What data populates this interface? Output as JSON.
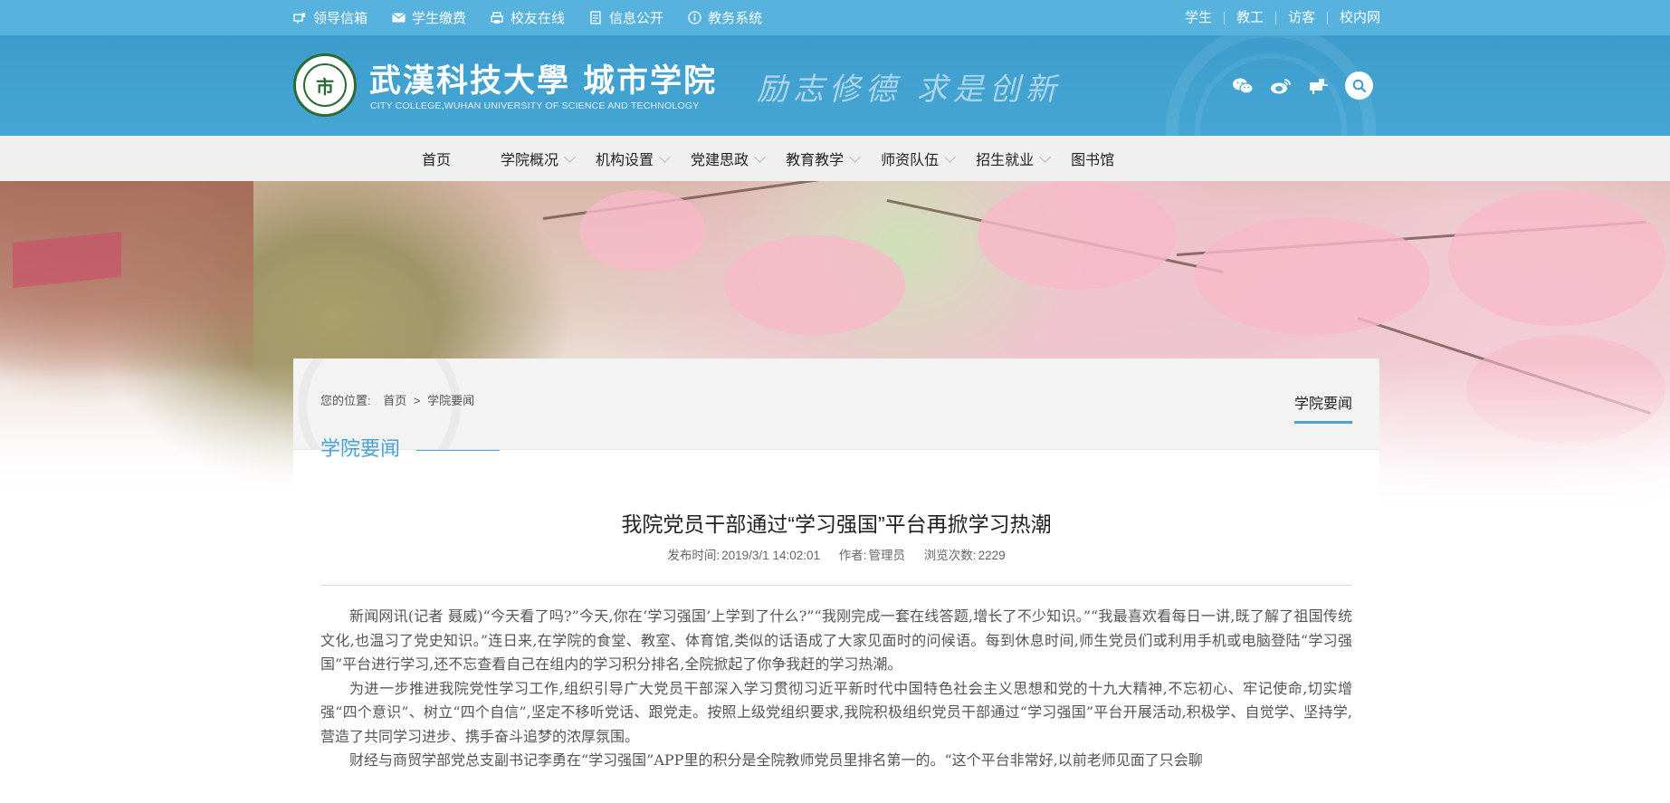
{
  "topbar": {
    "links": [
      {
        "label": "领导信箱",
        "icon": "mailbox-icon"
      },
      {
        "label": "学生缴费",
        "icon": "envelope-icon"
      },
      {
        "label": "校友在线",
        "icon": "printer-icon"
      },
      {
        "label": "信息公开",
        "icon": "document-icon"
      },
      {
        "label": "教务系统",
        "icon": "info-circle-icon"
      }
    ],
    "audience": [
      "学生",
      "教工",
      "访客",
      "校内网"
    ]
  },
  "header": {
    "logo_text": "市",
    "school_name": "武漢科技大學 城市学院",
    "school_name_en": "CITY COLLEGE,WUHAN UNIVERSITY OF SCIENCE AND TECHNOLOGY",
    "motto": "励志修德 求是创新",
    "social_icons": [
      "wechat-icon",
      "weibo-icon",
      "mailbox-icon",
      "search-icon"
    ],
    "bg_color": "#3d9ccb"
  },
  "nav": {
    "items": [
      {
        "label": "首页",
        "has_dropdown": false
      },
      {
        "label": "学院概况",
        "has_dropdown": true
      },
      {
        "label": "机构设置",
        "has_dropdown": true
      },
      {
        "label": "党建思政",
        "has_dropdown": true
      },
      {
        "label": "教育教学",
        "has_dropdown": true
      },
      {
        "label": "师资队伍",
        "has_dropdown": true
      },
      {
        "label": "招生就业",
        "has_dropdown": true
      },
      {
        "label": "图书馆",
        "has_dropdown": false
      }
    ]
  },
  "breadcrumb": {
    "prefix": "您的位置:",
    "home": "首页",
    "sep": ">",
    "current": "学院要闻"
  },
  "section": {
    "title": "学院要闻",
    "side_tab": "学院要闻",
    "accent": "#4aa3d3"
  },
  "article": {
    "title": "我院党员干部通过“学习强国”平台再掀学习热潮",
    "meta": {
      "published_label": "发布时间:",
      "published": "2019/3/1 14:02:01",
      "author_label": "作者:",
      "author": "管理员",
      "views_label": "浏览次数:",
      "views": "2229"
    },
    "paragraphs": [
      "新闻网讯(记者 聂威)“今天看了吗?”今天,你在‘学习强国’上学到了什么?”“我刚完成一套在线答题,增长了不少知识。”“我最喜欢看每日一讲,既了解了祖国传统文化,也温习了党史知识。”连日来,在学院的食堂、教室、体育馆,类似的话语成了大家见面时的问候语。每到休息时间,师生党员们或利用手机或电脑登陆“学习强国”平台进行学习,还不忘查看自己在组内的学习积分排名,全院掀起了你争我赶的学习热潮。",
      "为进一步推进我院党性学习工作,组织引导广大党员干部深入学习贯彻习近平新时代中国特色社会主义思想和党的十九大精神,不忘初心、牢记使命,切实增强“四个意识”、树立“四个自信”,坚定不移听党话、跟党走。按照上级党组织要求,我院积极组织党员干部通过“学习强国”平台开展活动,积极学、自觉学、坚持学,营造了共同学习进步、携手奋斗追梦的浓厚氛围。",
      "财经与商贸学部党总支副书记李勇在“学习强国”APP里的积分是全院教师党员里排名第一的。“这个平台非常好,以前老师见面了只会聊"
    ]
  }
}
